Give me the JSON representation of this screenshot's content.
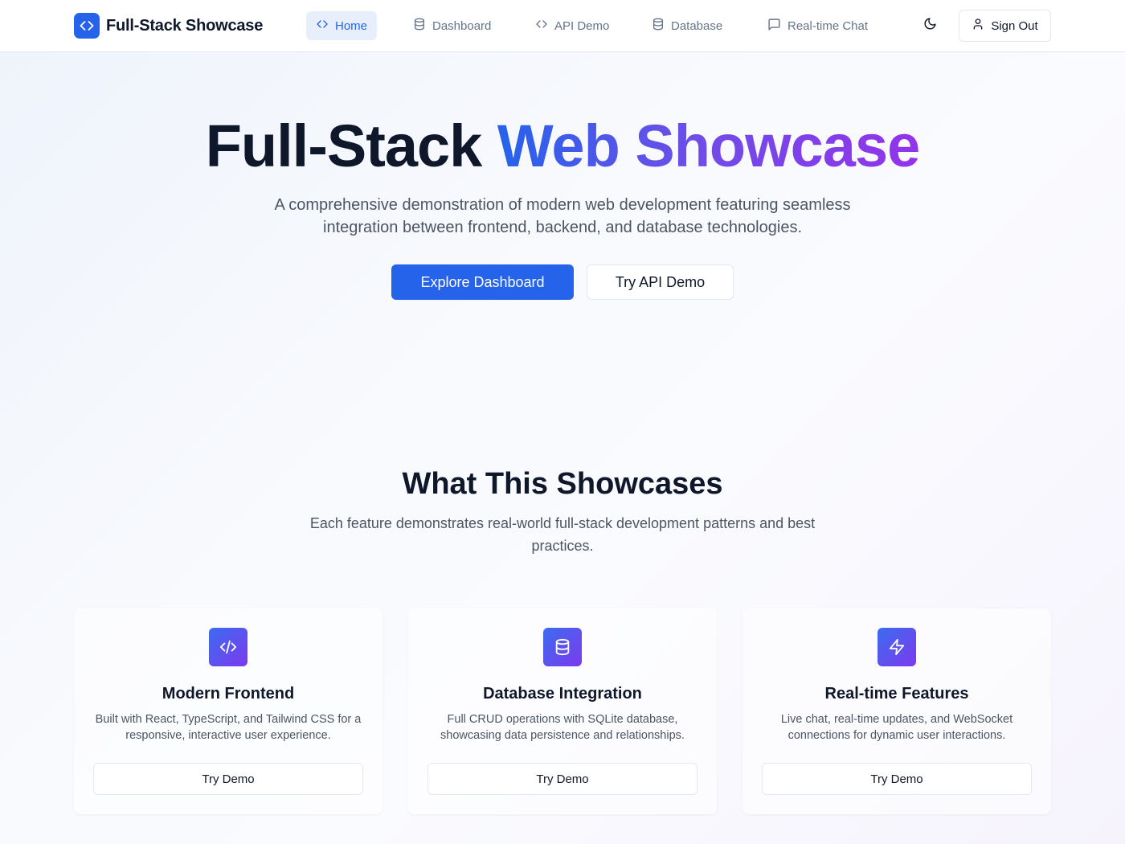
{
  "brand": {
    "title": "Full-Stack Showcase",
    "icon": "code-icon",
    "accent": "#2563eb"
  },
  "nav": {
    "items": [
      {
        "label": "Home",
        "icon": "code-icon",
        "active": true
      },
      {
        "label": "Dashboard",
        "icon": "database-icon",
        "active": false
      },
      {
        "label": "API Demo",
        "icon": "code-icon",
        "active": false
      },
      {
        "label": "Database",
        "icon": "database-icon",
        "active": false
      },
      {
        "label": "Real-time Chat",
        "icon": "message-square-icon",
        "active": false
      }
    ],
    "theme_toggle_icon": "moon-icon",
    "sign_out_label": "Sign Out",
    "sign_out_icon": "user-icon"
  },
  "hero": {
    "title_plain": "Full-Stack ",
    "title_gradient": "Web Showcase",
    "subtitle": "A comprehensive demonstration of modern web development featuring seamless integration between frontend, backend, and database technologies.",
    "primary_button": "Explore Dashboard",
    "secondary_button": "Try API Demo",
    "gradient_colors": [
      "#2563eb",
      "#9333ea"
    ]
  },
  "features": {
    "title": "What This Showcases",
    "subtitle": "Each feature demonstrates real-world full-stack development patterns and best practices.",
    "cards": [
      {
        "icon": "code-icon",
        "title": "Modern Frontend",
        "description": "Built with React, TypeScript, and Tailwind CSS for a responsive, interactive user experience.",
        "button": "Try Demo"
      },
      {
        "icon": "database-icon",
        "title": "Database Integration",
        "description": "Full CRUD operations with SQLite database, showcasing data persistence and relationships.",
        "button": "Try Demo"
      },
      {
        "icon": "zap-icon",
        "title": "Real-time Features",
        "description": "Live chat, real-time updates, and WebSocket connections for dynamic user interactions.",
        "button": "Try Demo"
      }
    ]
  }
}
